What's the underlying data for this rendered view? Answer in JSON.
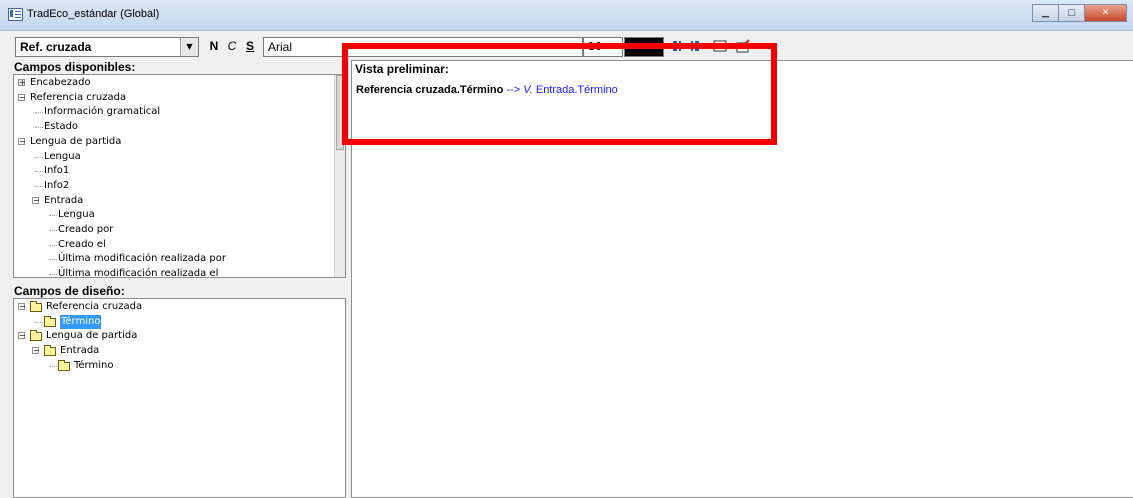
{
  "window": {
    "title": "TradEco_estándar (Global)",
    "buttons": [
      "minimize-button",
      "maximize-button",
      "close-button"
    ]
  },
  "toolbar": {
    "field_select_value": "Ref. cruzada",
    "bold_label": "N",
    "italic_label": "C",
    "underline_label": "S",
    "font_value": "Arial",
    "size_value": "10",
    "color_value": "#000000"
  },
  "available_fields": {
    "header": "Campos disponibles:",
    "items": [
      {
        "label": "Encabezado",
        "level": 0,
        "expander": "+"
      },
      {
        "label": "Referencia cruzada",
        "level": 0,
        "expander": "-"
      },
      {
        "label": "Información gramatical",
        "level": 1
      },
      {
        "label": "Estado",
        "level": 1
      },
      {
        "label": "Lengua de partida",
        "level": 0,
        "expander": "-"
      },
      {
        "label": "Lengua",
        "level": 1
      },
      {
        "label": "Info1",
        "level": 1
      },
      {
        "label": "Info2",
        "level": 1
      },
      {
        "label": "Entrada",
        "level": 1,
        "expander": "-"
      },
      {
        "label": "Lengua",
        "level": 2
      },
      {
        "label": "Creado por",
        "level": 2
      },
      {
        "label": "Creado el",
        "level": 2
      },
      {
        "label": "Última modificación realizada por",
        "level": 2
      },
      {
        "label": "Última modificación realizada el",
        "level": 2
      }
    ]
  },
  "design_fields": {
    "header": "Campos de diseño:",
    "items": [
      {
        "label": "Referencia cruzada",
        "level": 0,
        "expander": "-"
      },
      {
        "label": "Término",
        "level": 1,
        "selected": true
      },
      {
        "label": "Lengua de partida",
        "level": 0,
        "expander": "-"
      },
      {
        "label": "Entrada",
        "level": 1,
        "expander": "-"
      },
      {
        "label": "Término",
        "level": 2
      }
    ]
  },
  "preview": {
    "header": "Vista preliminar:",
    "field_name": "Referencia cruzada.Término",
    "arrow_text": " --> ",
    "abbrev": "V.",
    "target_text": " Entrada.Término"
  },
  "colors": {
    "highlight_box": "#f40000",
    "link_blue": "#1a1aff",
    "selection": "#3399ff"
  }
}
